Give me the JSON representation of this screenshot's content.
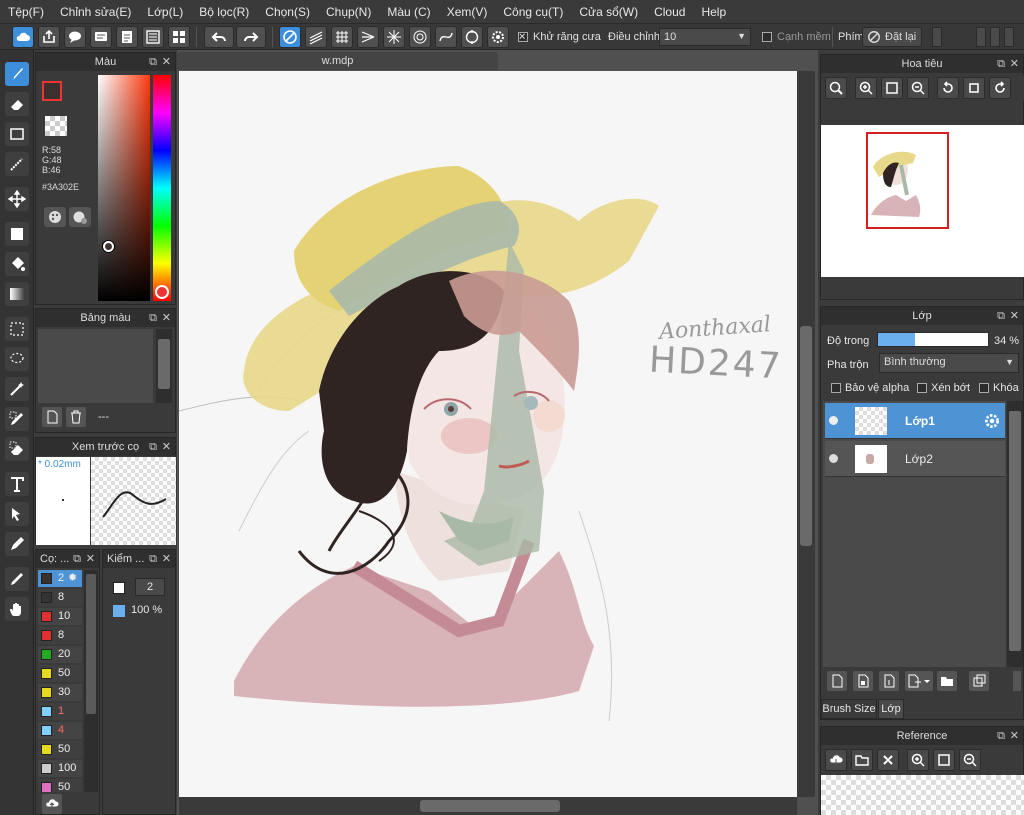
{
  "menu": [
    "Tệp(F)",
    "Chỉnh sửa(E)",
    "Lớp(L)",
    "Bộ lọc(R)",
    "Chọn(S)",
    "Chụp(N)",
    "Màu (C)",
    "Xem(V)",
    "Công cụ(T)",
    "Cửa sổ(W)",
    "Cloud",
    "Help"
  ],
  "toolbar": {
    "antialias_label": "Khử răng cưa",
    "correction_label": "Điều chỉnh",
    "correction_value": "10",
    "soft_edge_label": "Cạnh mềm",
    "key_label": "Phím",
    "reset_label": "Đặt lại"
  },
  "color_panel": {
    "title": "Màu",
    "r": "R:58",
    "g": "G:48",
    "b": "B:46",
    "hex": "#3A302E",
    "current_color": "#3a302e"
  },
  "palette_panel": {
    "title": "Bảng màu",
    "name": "---"
  },
  "brush_preview": {
    "title": "Xem trước cọ",
    "size": "* 0.02mm"
  },
  "brush_panel": {
    "title": "Cọ: ...",
    "items": [
      {
        "size": "2",
        "color": "#3a302e",
        "selected": true
      },
      {
        "size": "8",
        "color": "#333333"
      },
      {
        "size": "10",
        "color": "#e03030"
      },
      {
        "size": "8",
        "color": "#e03030"
      },
      {
        "size": "20",
        "color": "#22aa22"
      },
      {
        "size": "50",
        "color": "#e8d820"
      },
      {
        "size": "30",
        "color": "#e8d820"
      },
      {
        "size": "1",
        "color": "#7fd0ff",
        "highlight": true
      },
      {
        "size": "4",
        "color": "#7fd0ff",
        "highlight": true
      },
      {
        "size": "50",
        "color": "#e8d820"
      },
      {
        "size": "100",
        "color": "#cccccc"
      },
      {
        "size": "50",
        "color": "#e070c0"
      }
    ]
  },
  "style_panel": {
    "title": "Kiểm ...",
    "width": "2",
    "opacity": "100 %"
  },
  "document": {
    "title": "w.mdp",
    "signature_top": "Aonthaxal",
    "signature_bottom": "HD247"
  },
  "navigator": {
    "title": "Hoa tiêu"
  },
  "layers": {
    "title": "Lớp",
    "opacity_label": "Độ trong",
    "opacity_value": "34 %",
    "opacity_fraction": 0.34,
    "blend_label": "Pha trộn",
    "blend_value": "Bình thường",
    "protect_alpha": "Bảo vệ alpha",
    "clipping": "Xén bớt",
    "lock": "Khóa",
    "items": [
      {
        "name": "Lớp1",
        "selected": true
      },
      {
        "name": "Lớp2",
        "selected": false
      }
    ],
    "tab_brush_size": "Brush Size",
    "tab_layer": "Lớp"
  },
  "reference": {
    "title": "Reference"
  }
}
